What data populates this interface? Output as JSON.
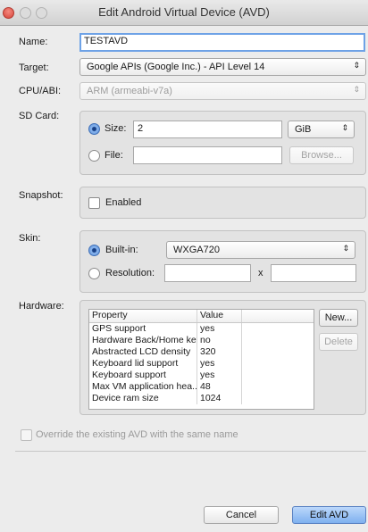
{
  "window": {
    "title": "Edit Android Virtual Device (AVD)"
  },
  "form": {
    "name_label": "Name:",
    "name_value": "TESTAVD",
    "target_label": "Target:",
    "target_value": "Google APIs (Google Inc.) - API Level 14",
    "cpu_label": "CPU/ABI:",
    "cpu_value": "ARM (armeabi-v7a)",
    "sdcard_label": "SD Card:",
    "size_radio_label": "Size:",
    "size_value": "2",
    "size_unit": "GiB",
    "file_radio_label": "File:",
    "file_value": "",
    "browse_label": "Browse...",
    "snapshot_label": "Snapshot:",
    "snapshot_enabled_label": "Enabled",
    "skin_label": "Skin:",
    "builtin_label": "Built-in:",
    "builtin_value": "WXGA720",
    "resolution_label": "Resolution:",
    "resolution_x": "x",
    "hardware_label": "Hardware:",
    "new_label": "New...",
    "delete_label": "Delete",
    "override_label": "Override the existing AVD with the same name"
  },
  "hardware_table": {
    "columns": [
      "Property",
      "Value"
    ],
    "rows": [
      [
        "GPS support",
        "yes"
      ],
      [
        "Hardware Back/Home keys",
        "no"
      ],
      [
        "Abstracted LCD density",
        "320"
      ],
      [
        "Keyboard lid support",
        "yes"
      ],
      [
        "Keyboard support",
        "yes"
      ],
      [
        "Max VM application hea...",
        "48"
      ],
      [
        "Device ram size",
        "1024"
      ]
    ]
  },
  "buttons": {
    "cancel": "Cancel",
    "edit": "Edit AVD"
  },
  "icons": {
    "select_arrows": "up-down-arrows",
    "window_controls": [
      "close",
      "minimize",
      "zoom"
    ]
  },
  "colors": {
    "accent": "#6ea2e6",
    "close_button": "#e0544a"
  }
}
